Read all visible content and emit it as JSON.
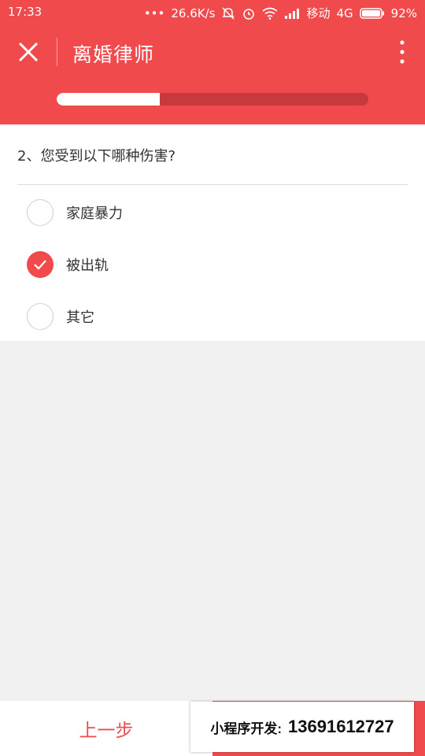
{
  "status_bar": {
    "time": "17:33",
    "dots": "•••",
    "speed": "26.6K/s",
    "carrier": "移动",
    "network": "4G",
    "battery": "92%"
  },
  "header": {
    "title": "离婚律师",
    "close_icon": "close-icon",
    "more_icon": "more-vertical-icon"
  },
  "progress": {
    "value": 0.33
  },
  "question": {
    "text": "2、您受到以下哪种伤害?",
    "options": [
      {
        "label": "家庭暴力",
        "checked": false
      },
      {
        "label": "被出轨",
        "checked": true
      },
      {
        "label": "其它",
        "checked": false
      }
    ]
  },
  "footer": {
    "prev_label": "上一步"
  },
  "watermark": {
    "label": "小程序开发:",
    "phone": "13691612727"
  },
  "colors": {
    "accent": "#f04a4d",
    "track": "#c63a3d",
    "background": "#f1f1f1"
  }
}
